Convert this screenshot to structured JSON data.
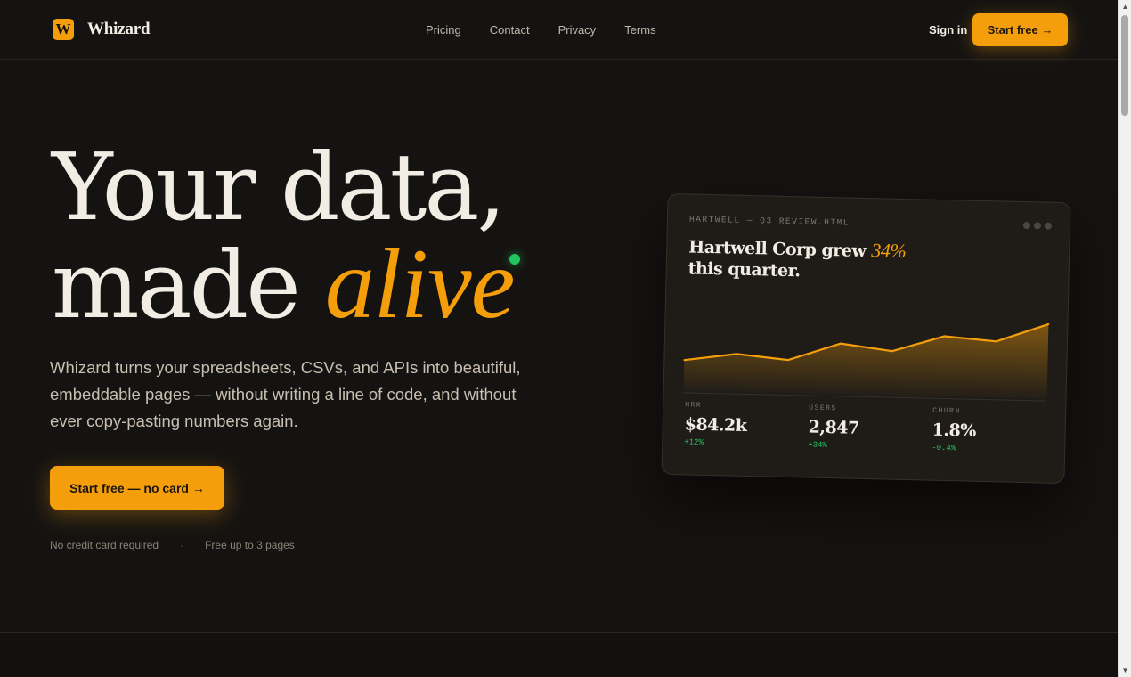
{
  "brand": {
    "logo_letter": "W",
    "name": "Whizard",
    "accent": "#f59e0b"
  },
  "nav": {
    "items": [
      "Pricing",
      "Contact",
      "Privacy",
      "Terms"
    ]
  },
  "header": {
    "signin": "Sign in",
    "start": "Start free →"
  },
  "hero": {
    "line1": "Your data,",
    "line2_plain": "made ",
    "line2_accent": "alive",
    "subtitle": "Whizard turns your spreadsheets, CSVs, and APIs into beautiful, embeddable pages — without writing a line of code, and without ever copy-pasting numbers again.",
    "cta": "Start free — no card →",
    "note1": "No credit card required",
    "note_sep": "·",
    "note2": "Free up to 3 pages"
  },
  "card": {
    "file": "HARTWELL — Q3 REVIEW.HTML",
    "title_pre": "Hartwell Corp grew ",
    "title_pct": "34%",
    "title_post": "this quarter.",
    "stats": [
      {
        "label": "MRR",
        "value": "$84.2k",
        "delta": "+12%"
      },
      {
        "label": "USERS",
        "value": "2,847",
        "delta": "+34%"
      },
      {
        "label": "CHURN",
        "value": "1.8%",
        "delta": "-0.4%"
      }
    ]
  },
  "chart_data": {
    "type": "area",
    "values": [
      38,
      47,
      41,
      63,
      55,
      75,
      70,
      93
    ],
    "ylim": [
      0,
      100
    ],
    "color": "#f59e0b"
  }
}
